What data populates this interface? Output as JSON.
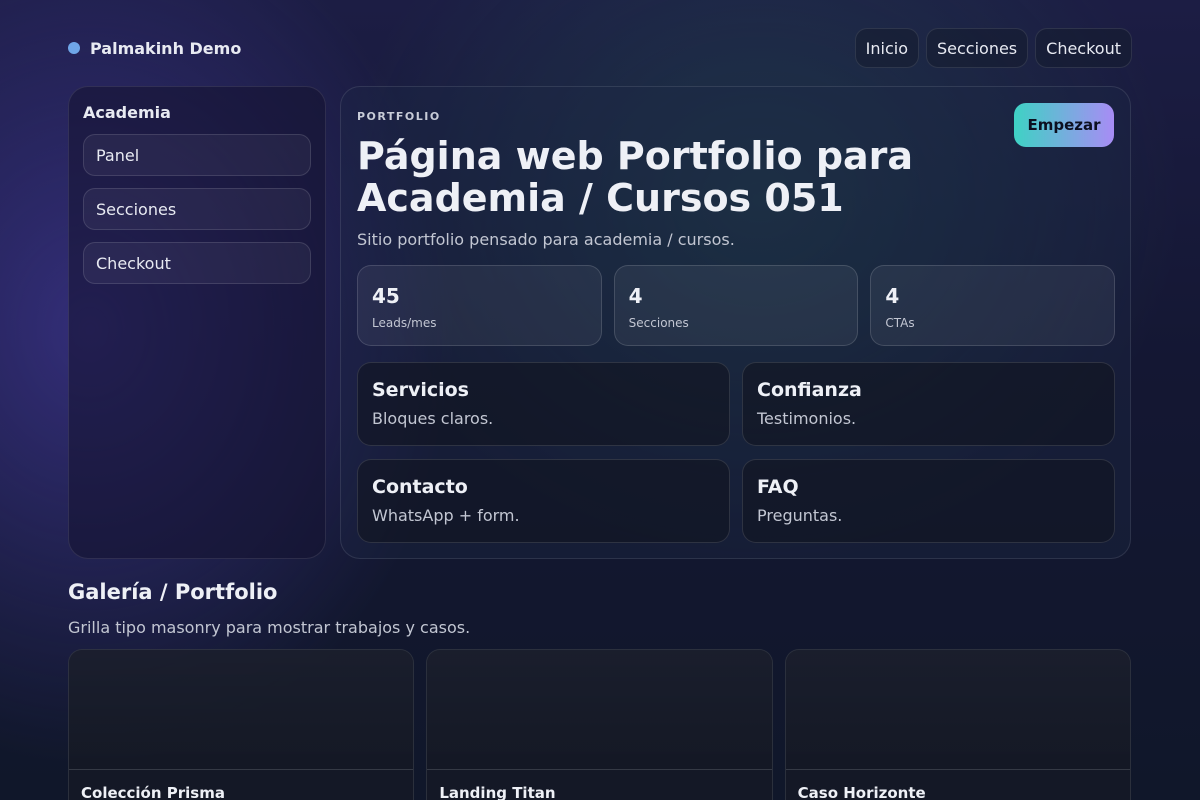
{
  "brand": {
    "name": "Palmakinh Demo",
    "dot_color": "#6fa6e8"
  },
  "nav": {
    "items": [
      {
        "label": "Inicio"
      },
      {
        "label": "Secciones"
      },
      {
        "label": "Checkout"
      }
    ]
  },
  "sidebar": {
    "title": "Academia",
    "items": [
      {
        "label": "Panel"
      },
      {
        "label": "Secciones"
      },
      {
        "label": "Checkout"
      }
    ]
  },
  "hero": {
    "eyebrow": "PORTFOLIO",
    "title": "Página web Portfolio para Academia / Cursos 051",
    "subtitle": "Sitio portfolio pensado para academia / cursos.",
    "cta_label": "Empezar",
    "cta_gradient": [
      "#3ed2c4",
      "#a88cf5"
    ]
  },
  "stats": [
    {
      "value": "45",
      "label": "Leads/mes"
    },
    {
      "value": "4",
      "label": "Secciones"
    },
    {
      "value": "4",
      "label": "CTAs"
    }
  ],
  "features": [
    {
      "title": "Servicios",
      "desc": "Bloques claros."
    },
    {
      "title": "Confianza",
      "desc": "Testimonios."
    },
    {
      "title": "Contacto",
      "desc": "WhatsApp + form."
    },
    {
      "title": "FAQ",
      "desc": "Preguntas."
    }
  ],
  "gallery": {
    "title": "Galería / Portfolio",
    "subtitle": "Grilla tipo masonry para mostrar trabajos y casos.",
    "items": [
      {
        "name": "Colección Prisma"
      },
      {
        "name": "Landing Titan"
      },
      {
        "name": "Caso Horizonte"
      }
    ]
  }
}
